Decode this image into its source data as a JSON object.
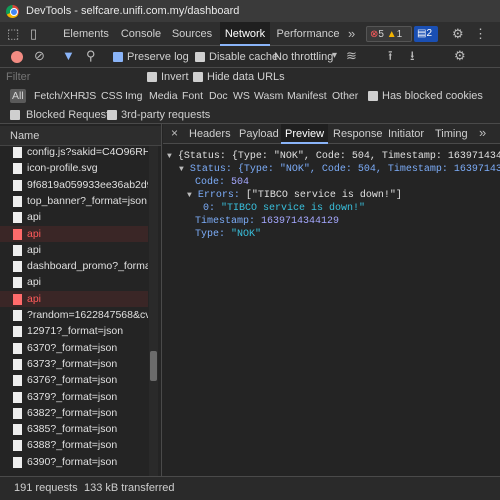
{
  "window": {
    "title": "DevTools - selfcare.unifi.com.my/dashboard"
  },
  "main_tabs": [
    "Elements",
    "Console",
    "Sources",
    "Network",
    "Performance"
  ],
  "active_main_tab": "Network",
  "badges": {
    "errors": "5",
    "warnings": "1",
    "messages": "2"
  },
  "toolbar": {
    "preserve_log": "Preserve log",
    "disable_cache": "Disable cache",
    "throttling": "No throttling"
  },
  "filter": {
    "placeholder": "Filter",
    "invert": "Invert",
    "hide_data_urls": "Hide data URLs"
  },
  "types": [
    "All",
    "Fetch/XHR",
    "JS",
    "CSS",
    "Img",
    "Media",
    "Font",
    "Doc",
    "WS",
    "Wasm",
    "Manifest",
    "Other"
  ],
  "has_blocked_cookies": "Has blocked cookies",
  "blocked_requests": "Blocked Requests",
  "third_party": "3rd-party requests",
  "list": {
    "header": "Name",
    "rows": [
      {
        "name": "config.js?sakid=C4O96RHPG",
        "error": false
      },
      {
        "name": "icon-profile.svg",
        "error": false
      },
      {
        "name": "9f6819a059933ee36ab2d956C",
        "error": false
      },
      {
        "name": "top_banner?_format=json",
        "error": false
      },
      {
        "name": "api",
        "error": false
      },
      {
        "name": "api",
        "error": true
      },
      {
        "name": "api",
        "error": false
      },
      {
        "name": "dashboard_promo?_format=js",
        "error": false
      },
      {
        "name": "api",
        "error": false
      },
      {
        "name": "api",
        "error": true
      },
      {
        "name": "?random=1622847568&cv=9",
        "error": false
      },
      {
        "name": "12971?_format=json",
        "error": false
      },
      {
        "name": "6370?_format=json",
        "error": false
      },
      {
        "name": "6373?_format=json",
        "error": false
      },
      {
        "name": "6376?_format=json",
        "error": false
      },
      {
        "name": "6379?_format=json",
        "error": false
      },
      {
        "name": "6382?_format=json",
        "error": false
      },
      {
        "name": "6385?_format=json",
        "error": false
      },
      {
        "name": "6388?_format=json",
        "error": false
      },
      {
        "name": "6390?_format=json",
        "error": false
      }
    ]
  },
  "detail_tabs": [
    "Headers",
    "Payload",
    "Preview",
    "Response",
    "Initiator",
    "Timing"
  ],
  "active_detail_tab": "Preview",
  "preview": {
    "line1": "{Status: {Type: \"NOK\", Code: 504, Timestamp: 1639714344129, Er",
    "line2": "Status: {Type: \"NOK\", Code: 504, Timestamp: 1639714344129, E",
    "code_key": "Code:",
    "code_val": "504",
    "errors_key": "Errors:",
    "errors_summary": "[\"TIBCO service is down!\"]",
    "err0_key": "0:",
    "err0_val": "\"TIBCO service is down!\"",
    "ts_key": "Timestamp:",
    "ts_val": "1639714344129",
    "type_key": "Type:",
    "type_val": "\"NOK\""
  },
  "status": {
    "requests": "191 requests",
    "transferred": "133 kB transferred"
  }
}
